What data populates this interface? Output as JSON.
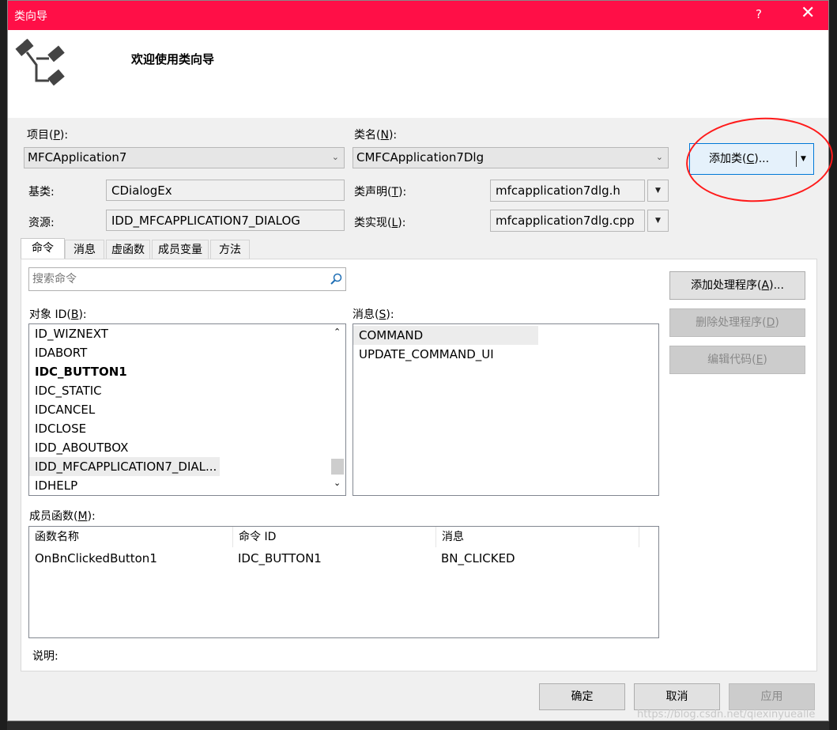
{
  "dialog": {
    "title": "类向导",
    "help_glyph": "?",
    "close_glyph": "✕",
    "welcome": "欢迎使用类向导"
  },
  "project": {
    "label": "项目(",
    "key": "P",
    "label_end": "):",
    "value": "MFCApplication7"
  },
  "classname": {
    "label": "类名(",
    "key": "N",
    "label_end": "):",
    "value": "CMFCApplication7Dlg"
  },
  "add_class_button": {
    "label": "添加类(",
    "key": "C",
    "label_end": ")..."
  },
  "base_class": {
    "label": "基类:",
    "value": "CDialogEx"
  },
  "resource": {
    "label": "资源:",
    "value": "IDD_MFCAPPLICATION7_DIALOG"
  },
  "class_decl": {
    "label": "类声明(",
    "key": "T",
    "label_end": "):",
    "value": "mfcapplication7dlg.h"
  },
  "class_impl": {
    "label": "类实现(",
    "key": "L",
    "label_end": "):",
    "value": "mfcapplication7dlg.cpp"
  },
  "tabs": [
    {
      "label": "命令"
    },
    {
      "label": "消息"
    },
    {
      "label": "虚函数"
    },
    {
      "label": "成员变量"
    },
    {
      "label": "方法"
    }
  ],
  "search": {
    "placeholder": "搜索命令"
  },
  "object_ids": {
    "label": "对象 ID(",
    "key": "B",
    "label_end": "):",
    "items": [
      "ID_WIZNEXT",
      "IDABORT",
      "IDC_BUTTON1",
      "IDC_STATIC",
      "IDCANCEL",
      "IDCLOSE",
      "IDD_ABOUTBOX",
      "IDD_MFCAPPLICATION7_DIAL...",
      "IDHELP"
    ]
  },
  "messages": {
    "label": "消息(",
    "key": "S",
    "label_end": "):",
    "items": [
      "COMMAND",
      "UPDATE_COMMAND_UI"
    ]
  },
  "actions": {
    "add_handler": {
      "label": "添加处理程序(",
      "key": "A",
      "label_end": ")..."
    },
    "delete_handler": {
      "label": "删除处理程序(",
      "key": "D",
      "label_end": ")"
    },
    "edit_code": {
      "label": "编辑代码(",
      "key": "E",
      "label_end": ")"
    }
  },
  "member_functions": {
    "label": "成员函数(",
    "key": "M",
    "label_end": "):",
    "columns": [
      "函数名称",
      "命令 ID",
      "消息"
    ],
    "rows": [
      [
        "OnBnClickedButton1",
        "IDC_BUTTON1",
        "BN_CLICKED"
      ]
    ]
  },
  "description": {
    "label": "说明:"
  },
  "footer": {
    "ok": "确定",
    "cancel": "取消",
    "apply": "应用"
  },
  "watermark": "https://blog.csdn.net/qiexinyuealle",
  "colors": {
    "titlebar": "#ff0f47",
    "annotation": "#ff1a1a"
  }
}
